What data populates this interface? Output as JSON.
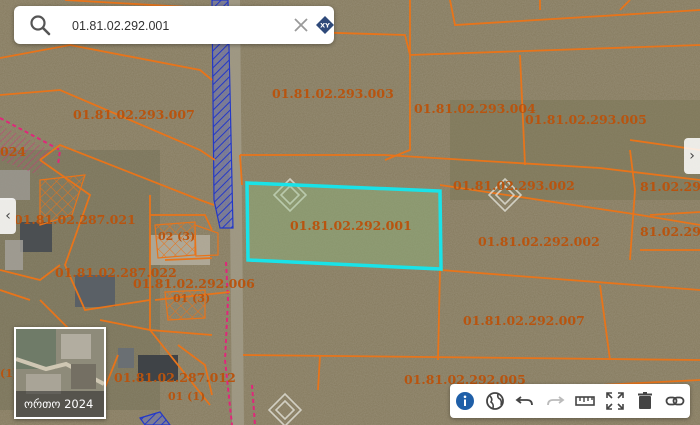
{
  "search": {
    "value": "01.81.02.292.001"
  },
  "parcels": [
    {
      "id": "01.81.02.293.003"
    },
    {
      "id": "01.81.02.293.004"
    },
    {
      "id": "01.81.02.293.005"
    },
    {
      "id": "01.81.02.293.007"
    },
    {
      "id": "01.81.02.293.002"
    },
    {
      "id": "01.81.02.292.001"
    },
    {
      "id": "01.81.02.292.002"
    },
    {
      "id": "01.81.02.287.021"
    },
    {
      "id": "01.81.02.287.022"
    },
    {
      "id": "01.81.02.292.006"
    },
    {
      "id": "01.81.02.292.007"
    },
    {
      "id": "01.81.02.287.012"
    },
    {
      "id": "01.81.02.292.005"
    },
    {
      "id": "024"
    },
    {
      "id": "81.02.29"
    },
    {
      "id": "81.02.29"
    },
    {
      "id": "02 (3)"
    },
    {
      "id": "01 (3)"
    },
    {
      "id": "01 (1)"
    },
    {
      "id": "(1)"
    }
  ],
  "basemap": {
    "label": "ორთო 2024"
  },
  "toolbar": {
    "tools": [
      "info-icon",
      "globe-icon",
      "undo-icon",
      "redo-icon",
      "ruler-icon",
      "fullscreen-icon",
      "trash-icon",
      "link-icon"
    ]
  },
  "colors": {
    "parcel_border": "#e8741a",
    "selected_border": "#19e3e8",
    "parcel_label": "#b8540f",
    "road_hatch": "#2338c8",
    "info_active": "#1f5fa8"
  }
}
